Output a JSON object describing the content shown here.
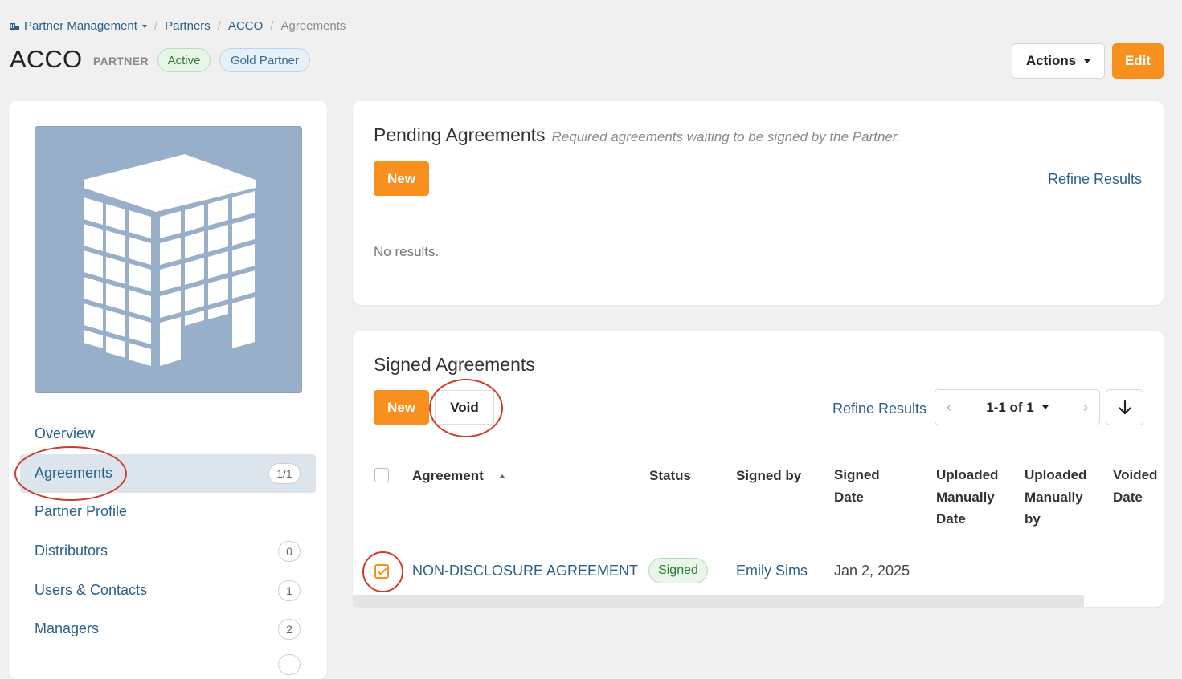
{
  "breadcrumb": {
    "module": "Partner Management",
    "partners": "Partners",
    "partner": "ACCO",
    "current": "Agreements"
  },
  "header": {
    "title": "ACCO",
    "type_label": "PARTNER",
    "status_badge": "Active",
    "tier_badge": "Gold Partner",
    "actions_label": "Actions",
    "edit_label": "Edit"
  },
  "sidebar": {
    "logo_icon": "building-icon",
    "items": [
      {
        "label": "Overview",
        "count": ""
      },
      {
        "label": "Agreements",
        "count": "1/1",
        "selected": true
      },
      {
        "label": "Partner Profile",
        "count": ""
      },
      {
        "label": "Distributors",
        "count": "0"
      },
      {
        "label": "Users & Contacts",
        "count": "1"
      },
      {
        "label": "Managers",
        "count": "2"
      }
    ]
  },
  "pending": {
    "title": "Pending Agreements",
    "subtitle": "Required agreements waiting to be signed by the Partner.",
    "new_label": "New",
    "refine_label": "Refine Results",
    "empty_text": "No results."
  },
  "signed": {
    "title": "Signed Agreements",
    "new_label": "New",
    "void_label": "Void",
    "refine_label": "Refine Results",
    "pager_text": "1-1 of 1",
    "columns": {
      "agreement": "Agreement",
      "status": "Status",
      "signed_by": "Signed by",
      "signed_date": [
        "Signed",
        "Date"
      ],
      "uploaded_date": [
        "Uploaded",
        "Manually",
        "Date"
      ],
      "uploaded_by": [
        "Uploaded",
        "Manually",
        "by"
      ],
      "voided_date": [
        "Voided",
        "Date"
      ]
    },
    "rows": [
      {
        "agreement": "NON-DISCLOSURE AGREEMENT",
        "status": "Signed",
        "signed_by": "Emily Sims",
        "signed_date": "Jan 2, 2025",
        "checked": true
      }
    ]
  },
  "colors": {
    "accent": "#f7901e",
    "link": "#2a5f89",
    "annotation": "#d03b2c",
    "logo_bg": "#97afc8"
  }
}
